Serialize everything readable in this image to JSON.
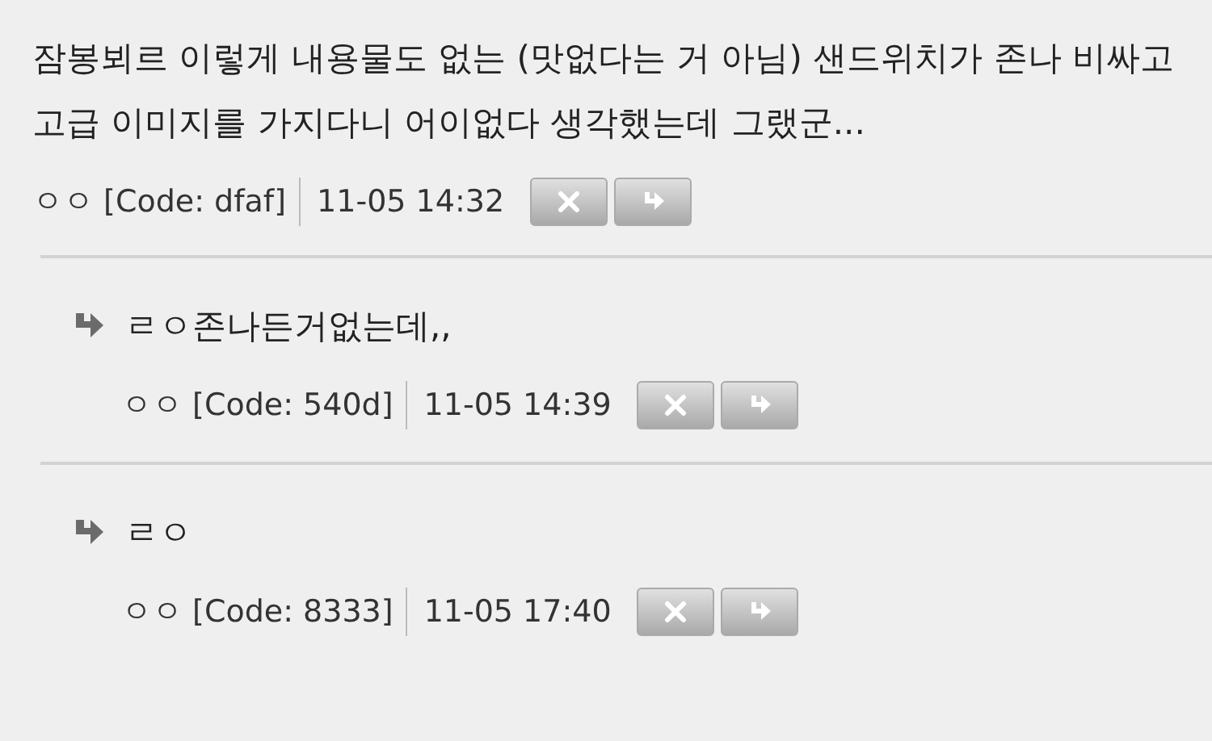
{
  "comment": {
    "text": "잠봉뵈르 이렇게 내용물도 없는 (맛없다는 거 아님) 샌드위치가 존나 비싸고 고급 이미지를 가지다니 어이없다 생각했는데 그랬군...",
    "author": "ㅇㅇ",
    "code": "[Code: dfaf]",
    "time": "11-05 14:32"
  },
  "replies": [
    {
      "text": "ㄹㅇ존나든거없는데,,",
      "author": "ㅇㅇ",
      "code": "[Code: 540d]",
      "time": "11-05 14:39"
    },
    {
      "text": "ㄹㅇ",
      "author": "ㅇㅇ",
      "code": "[Code: 8333]",
      "time": "11-05 17:40"
    }
  ]
}
